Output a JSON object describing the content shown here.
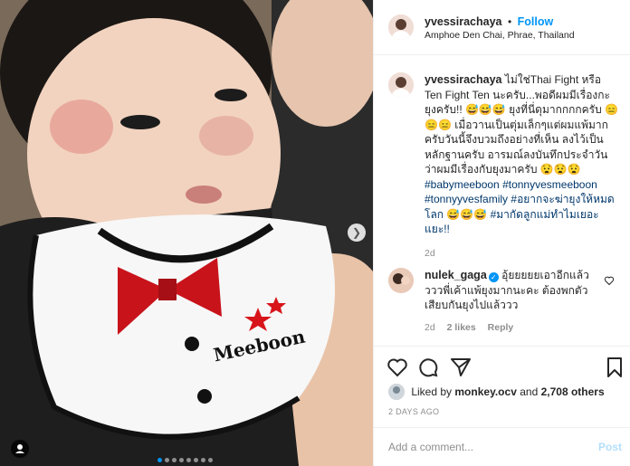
{
  "header": {
    "username": "yvessirachaya",
    "separator": "•",
    "follow_label": "Follow",
    "location": "Amphoe Den Chai, Phrae, Thailand"
  },
  "caption": {
    "username": "yvessirachaya",
    "text": "ไม่ใช่Thai Fight หรือ Ten Fight Ten นะครับ...พอดีผมมีเรื่องกะยุงครับ!! 😅😅😅 ยุงที่นี่ดุมากกกกครับ 😑😑😑 เมื่อวานเป็นตุ่มเล็กๆแต่ผมแพ้มากครับวันนี้จึงบวมถึงอย่างที่เห็น ลงไว้เป็นหลักฐานครับ อารมณ์ลงบันทึกประจำวันว่าผมมีเรื่องกับยุงมาครับ 😧😧😧",
    "hashtags": [
      "#babymeeboon",
      "#tonnyvesmeeboon",
      "#tonnyyvesfamily",
      "#อยากจะฆ่ายุงให้หมดโลก 😅😅😅",
      "#มากัดลูกแม่ทำไมเยอะแยะ!!"
    ],
    "age": "2d"
  },
  "comment": {
    "username": "nulek_gaga",
    "verified_glyph": "✓",
    "text": "อุ้ยยยยยเอาอีกแล้ววววพี่เค้าแพ้ยุงมากนะคะ ต้องพกตัวเสียบกันยุงไปแล้ววว",
    "age": "2d",
    "likes": "2 likes",
    "reply_label": "Reply"
  },
  "likes": {
    "prefix": "Liked by",
    "user": "monkey.ocv",
    "conj": "and",
    "others": "2,708 others"
  },
  "timestamp": "2 DAYS AGO",
  "add_comment": {
    "placeholder": "Add a comment...",
    "post_label": "Post"
  },
  "photo": {
    "bib_text": "Meeboon",
    "carousel_count": 8,
    "carousel_active": 1
  },
  "colors": {
    "accent": "#0095f6",
    "hashtag": "#00376b",
    "muted": "#8e8e8e"
  }
}
